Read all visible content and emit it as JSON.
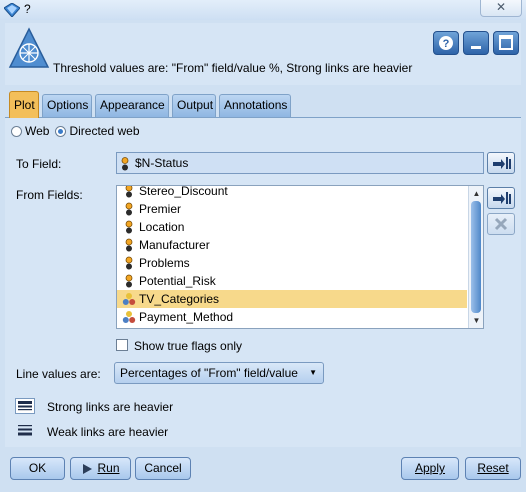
{
  "window": {
    "title": "?",
    "close_label": "✕"
  },
  "header": {
    "description": "Threshold values are: \"From\" field/value %,   Strong links are heavier"
  },
  "tabs": [
    {
      "label": "Plot",
      "active": true
    },
    {
      "label": "Options",
      "active": false
    },
    {
      "label": "Appearance",
      "active": false
    },
    {
      "label": "Output",
      "active": false
    },
    {
      "label": "Annotations",
      "active": false
    }
  ],
  "plot": {
    "web_label": "Web",
    "directed_web_label": "Directed web",
    "selected_mode": "Directed web",
    "to_field_label": "To Field:",
    "to_field_value": "$N-Status",
    "from_fields_label": "From Fields:",
    "from_fields": [
      {
        "name": "Stereo_Discount",
        "type": "flag",
        "selected": false
      },
      {
        "name": "Premier",
        "type": "flag",
        "selected": false
      },
      {
        "name": "Location",
        "type": "flag",
        "selected": false
      },
      {
        "name": "Manufacturer",
        "type": "flag",
        "selected": false
      },
      {
        "name": "Problems",
        "type": "flag",
        "selected": false
      },
      {
        "name": "Potential_Risk",
        "type": "flag",
        "selected": false
      },
      {
        "name": "TV_Categories",
        "type": "set",
        "selected": true
      },
      {
        "name": "Payment_Method",
        "type": "set",
        "selected": false
      }
    ],
    "show_true_flags_label": "Show true flags only",
    "show_true_flags_checked": false,
    "line_values_label": "Line values are:",
    "line_values_value": "Percentages of \"From\" field/value",
    "legend": [
      {
        "label": "Strong links are heavier"
      },
      {
        "label": "Weak links are heavier"
      }
    ]
  },
  "buttons": {
    "ok": "OK",
    "run": "Run",
    "cancel": "Cancel",
    "apply": "Apply",
    "reset": "Reset"
  },
  "colors": {
    "active_tab": "#f3bf5a",
    "selected_row": "#f7d98b",
    "panel_bg": "#d6e5f5"
  }
}
